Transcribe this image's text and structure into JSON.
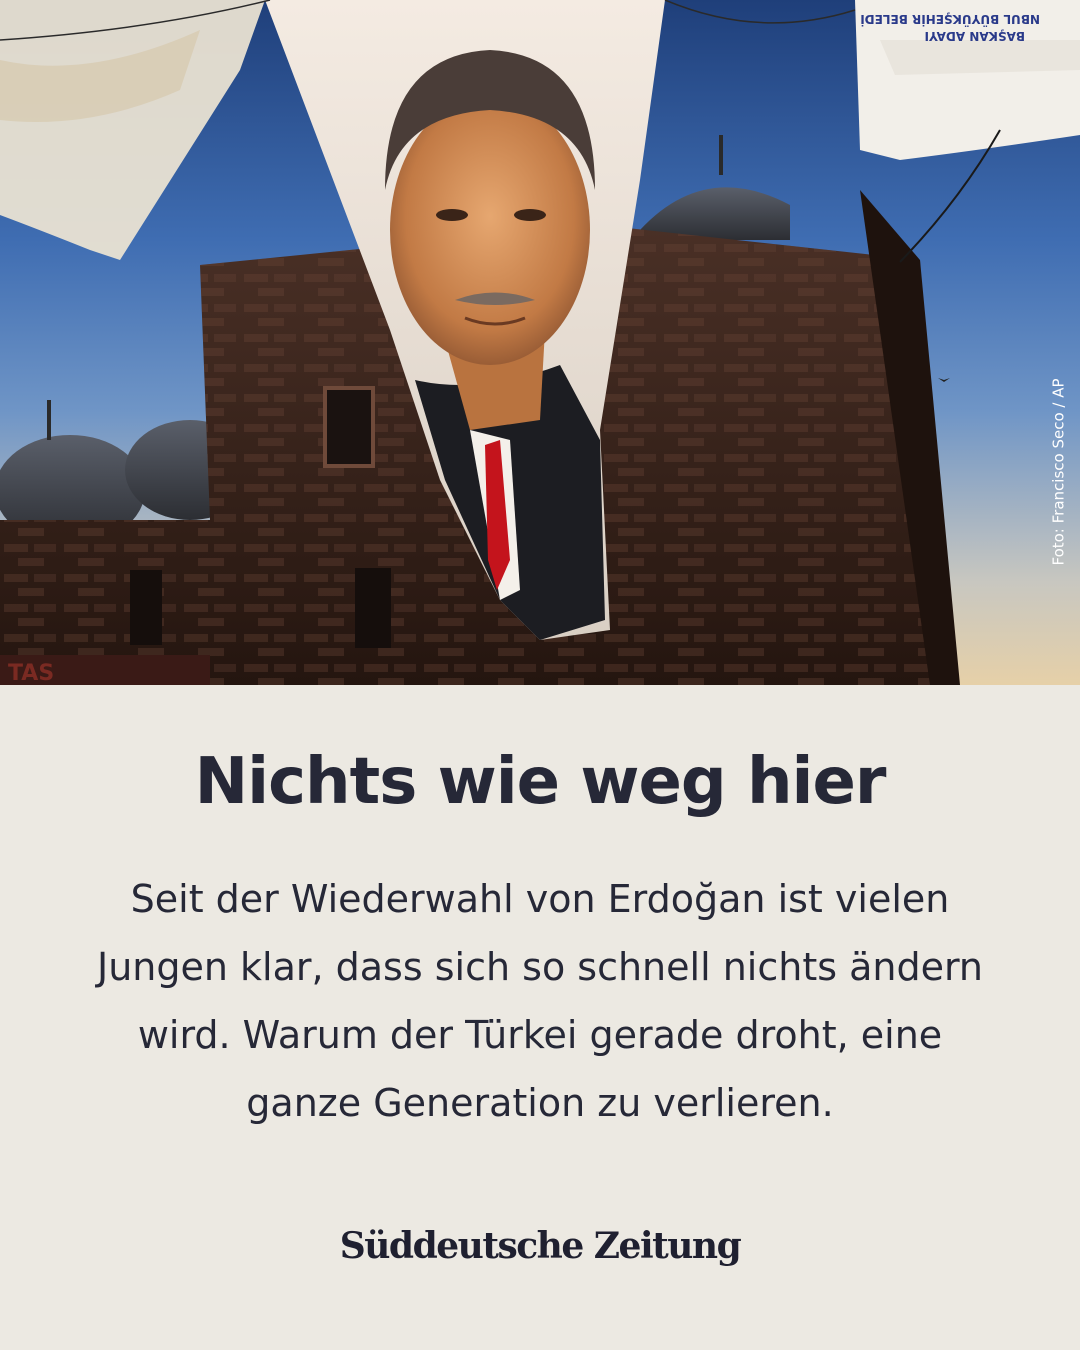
{
  "photo": {
    "alt_icon": "portrait-banner-photo",
    "credit": "Foto: Francisco Seco / AP",
    "banner_text_top_right_line1": "NBUL BÜYÜKŞEHİR BELEDİ",
    "banner_text_top_right_line2": "BAŞKAN ADAYI",
    "sign_text": "TAS"
  },
  "article": {
    "headline": "Nichts wie weg hier",
    "teaser": "Seit der Wiederwahl von Erdoğan ist vielen Jungen klar, dass sich so schnell nichts ändern wird. Warum der Türkei gerade droht, eine ganze Generation zu verlieren."
  },
  "brand": {
    "logo_text": "Süddeutsche Zeitung"
  },
  "colors": {
    "background": "#ece9e2",
    "text": "#262837"
  }
}
